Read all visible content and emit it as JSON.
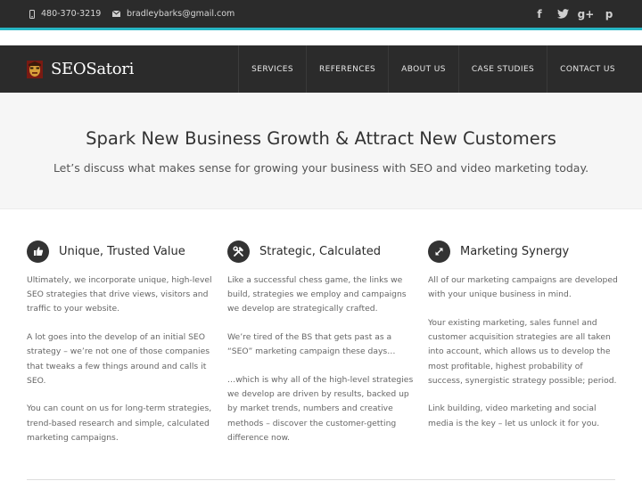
{
  "topbar": {
    "phone": "480-370-3219",
    "email": "bradleybarks@gmail.com",
    "social": [
      {
        "name": "facebook-icon",
        "glyph": "f"
      },
      {
        "name": "twitter-icon",
        "glyph": "t"
      },
      {
        "name": "google-plus-icon",
        "glyph": "g+"
      },
      {
        "name": "pinterest-icon",
        "glyph": "p"
      }
    ],
    "accent_color": "#27b6c4"
  },
  "nav": {
    "logo_text": "SEOSatori",
    "items": [
      "SERVICES",
      "REFERENCES",
      "ABOUT US",
      "CASE STUDIES",
      "CONTACT US"
    ]
  },
  "hero": {
    "title": "Spark New Business Growth & Attract New Customers",
    "subtitle": "Let’s discuss what makes sense for growing your business with SEO and video marketing today."
  },
  "columns": [
    {
      "icon": "thumbs-up-icon",
      "title": "Unique, Trusted Value",
      "paragraphs": [
        "Ultimately, we incorporate unique, high-level SEO strategies that drive views, visitors and traffic to your website.",
        "A lot goes into the develop of an initial SEO strategy – we’re not one of those companies that tweaks a few things around and calls it SEO.",
        "You can count on us for long-term strategies, trend-based research and simple, calculated marketing campaigns."
      ]
    },
    {
      "icon": "tools-icon",
      "title": "Strategic, Calculated",
      "paragraphs": [
        "Like a successful chess game, the links we build, strategies we employ and campaigns we develop are strategically crafted.",
        "We’re tired of the BS that gets past as a “SEO” marketing campaign these days…",
        "…which is why all of the high-level strategies we develop are driven by results, backed up by market trends, numbers and creative methods – discover the customer-getting difference now."
      ]
    },
    {
      "icon": "expand-arrows-icon",
      "title": "Marketing Synergy",
      "paragraphs": [
        "All of our marketing campaigns are developed with your unique business in mind.",
        "Your existing marketing, sales funnel and customer acquisition strategies are all taken into account, which allows us to develop the most profitable, highest probability of success, synergistic strategy possible; period.",
        "Link building, video marketing and social media is the key – let us unlock it for you."
      ]
    }
  ]
}
